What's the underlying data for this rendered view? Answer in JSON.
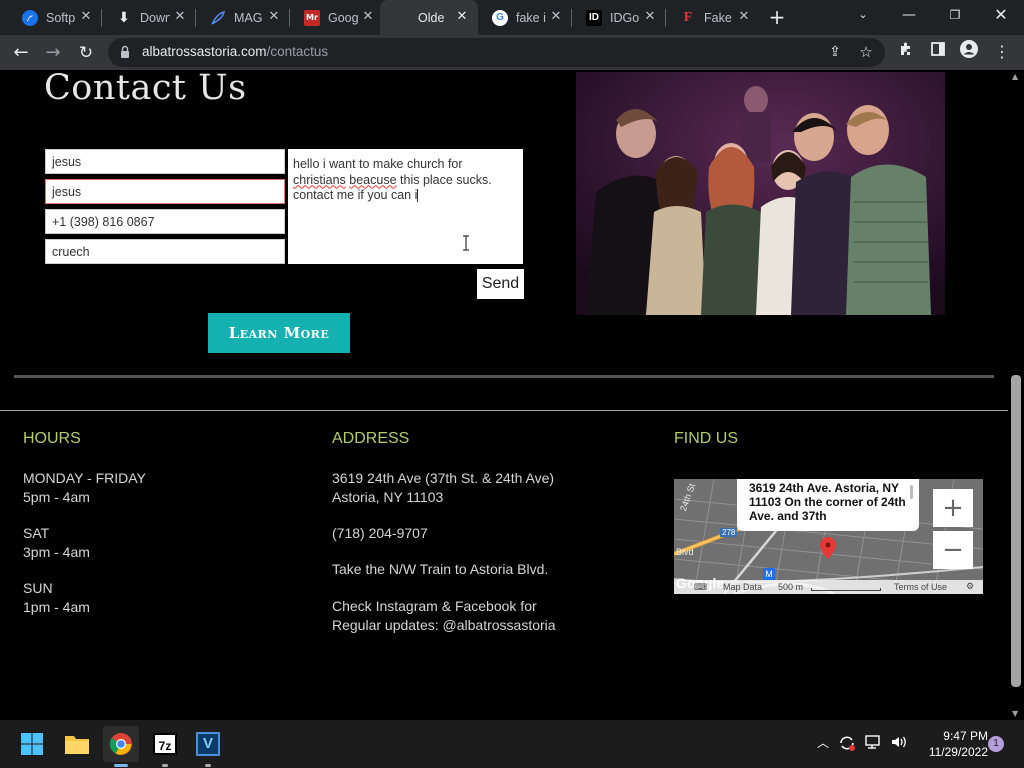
{
  "browser": {
    "tabs": [
      {
        "title": "Softp",
        "fav_text": "",
        "fav_color": "#1a73e8"
      },
      {
        "title": "Down",
        "fav_text": "⬇",
        "fav_color": "transparent"
      },
      {
        "title": "MAG",
        "fav_text": "",
        "fav_color": "#4c8bf5"
      },
      {
        "title": "Goog",
        "fav_text": "Mr",
        "fav_color": "#c62828"
      },
      {
        "title": "Olde",
        "fav_text": "",
        "fav_color": "transparent"
      },
      {
        "title": "fake i",
        "fav_text": "G",
        "fav_color": "#ffffff"
      },
      {
        "title": "IDGo",
        "fav_text": "ID",
        "fav_color": "#000000"
      },
      {
        "title": "Fake",
        "fav_text": "F",
        "fav_color": "transparent"
      }
    ],
    "url_domain": "albatrossastoria.com",
    "url_path": "/contactus"
  },
  "contact": {
    "title": "Contact Us",
    "first_name": "jesus",
    "last_name": "jesus",
    "phone": "+1 (398) 816 0867",
    "subject": "cruech",
    "message_line1": "hello i want to make church for",
    "message_word_christians": "christians",
    "message_word_beacuse": "beacuse",
    "message_line2_rest": "this place sucks.",
    "message_line3": "contact me if you can i",
    "send_label": "Send",
    "learn_more_label": "Learn More"
  },
  "footer": {
    "hours_heading": "HOURS",
    "hours": [
      {
        "days": "MONDAY - FRIDAY",
        "time": "5pm - 4am"
      },
      {
        "days": "SAT",
        "time": "3pm - 4am"
      },
      {
        "days": "SUN",
        "time": "1pm - 4am"
      }
    ],
    "address_heading": "ADDRESS",
    "address_line1": "3619 24th Ave (37th St. & 24th Ave)",
    "address_line2": "Astoria, NY 11103",
    "phone": "(718) 204-9707",
    "train": "Take the N/W Train to Astoria Blvd.",
    "social_line1": "Check Instagram & Facebook for",
    "social_line2": "Regular updates: @albatrossastoria",
    "find_us_heading": "FIND US"
  },
  "map": {
    "bubble_text": "3619 24th Ave. Astoria, NY 11103 On the corner of 24th Ave. and 37th",
    "zoom_in": "+",
    "zoom_out": "−",
    "map_data": "Map Data",
    "scale": "500 m",
    "terms": "Terms of Use",
    "road_label": "278",
    "street_label": "Blvd",
    "street_label2": "24th St",
    "metro_label": "M",
    "brand": "Google"
  },
  "taskbar": {
    "time": "9:47 PM",
    "date": "11/29/2022",
    "notifications": "1",
    "app_7z": "7z",
    "app_v": "V"
  },
  "colors": {
    "accent_teal": "#15b0b0",
    "heading_green": "#b2cc6b"
  }
}
